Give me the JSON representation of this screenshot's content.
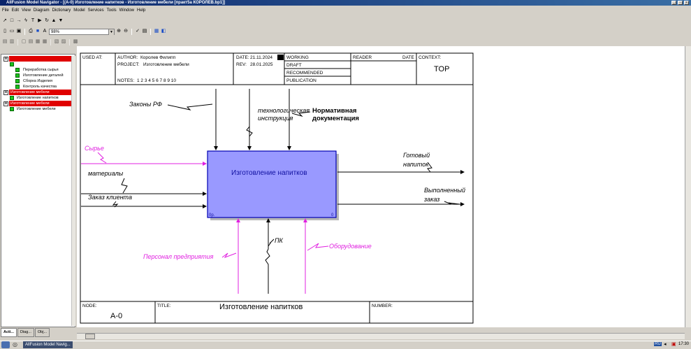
{
  "window": {
    "title": "AllFusion Model Navigator - [(A-0) Изготовление напитков     - Изготовление мебели  [практ5а КОРОЛЕВ.bp1]]",
    "minimize_glyph": "_",
    "maximize_glyph": "▫",
    "close_glyph": "×"
  },
  "menu": [
    "File",
    "Edit",
    "View",
    "Diagram",
    "Dictionary",
    "Model",
    "Services",
    "Tools",
    "Window",
    "Help"
  ],
  "toolbar": {
    "zoom_value": "98%",
    "row1_icons": [
      "pointer-icon",
      "box-tool-icon",
      "arrow-tool-icon",
      "squiggle-tool-icon",
      "text-tool-icon",
      "play-icon",
      "rotate-icon",
      "go-up-icon",
      "go-down-icon"
    ]
  },
  "tree": {
    "items": [
      {
        "label": "",
        "level": 0,
        "selected": true
      },
      {
        "label": "Переработка сырья",
        "level": 2
      },
      {
        "label": "Изготовление деталей",
        "level": 2
      },
      {
        "label": "Сборка Изделия",
        "level": 2
      },
      {
        "label": "Контроль качества",
        "level": 2
      },
      {
        "label": "Изготовление мебели",
        "level": 0,
        "selected": true
      },
      {
        "label": "Изготовление напитков",
        "level": 1
      },
      {
        "label": "Изготовление мебели",
        "level": 0,
        "selected": true
      },
      {
        "label": "Изготовление мебели",
        "level": 1
      }
    ],
    "tabs": [
      "Acti...",
      "Diag...",
      "Obj..."
    ]
  },
  "header": {
    "used_at_label": "USED AT:",
    "author_label": "AUTHOR:",
    "author": "Королев Филипп",
    "project_label": "PROJECT:",
    "project": "Изготовление мебели",
    "date_label": "DATE:",
    "date": "21.11.2024",
    "rev_label": "REV:",
    "rev": "28.01.2025",
    "notes_label": "NOTES:",
    "notes": "1  2  3  4  5  6  7  8  9  10",
    "statuses": [
      "WORKING",
      "DRAFT",
      "RECOMMENDED",
      "PUBLICATION"
    ],
    "reader_label": "READER",
    "date2_label": "DATE",
    "context_label": "CONTEXT:",
    "context_value": "TOP"
  },
  "diagram": {
    "activity": "Изготовление напитков",
    "activity_cost": "0р.",
    "activity_number": "0",
    "controls": [
      "Законы РФ",
      "технологическая инструкция",
      "Нормативная документация"
    ],
    "inputs": [
      "Сырье",
      "материалы",
      "Заказ клиента"
    ],
    "outputs": [
      "Готовый напиток",
      "Выполненный заказ"
    ],
    "mechanisms": [
      "ПК",
      "Оборудование",
      "Персонал предприятия"
    ]
  },
  "footer": {
    "node_label": "NODE:",
    "node": "A-0",
    "title_label": "TITLE:",
    "title": "Изготовление напитков",
    "number_label": "NUMBER:"
  },
  "taskbar": {
    "app_button": "AllFusion Model Navig...",
    "lang": "RU",
    "time": "17:30"
  },
  "colors": {
    "activity_fill": "#9999ff",
    "activity_border": "#0000b0",
    "magenta_arrow": "#e020e0",
    "selected_tree": "#e00000"
  }
}
